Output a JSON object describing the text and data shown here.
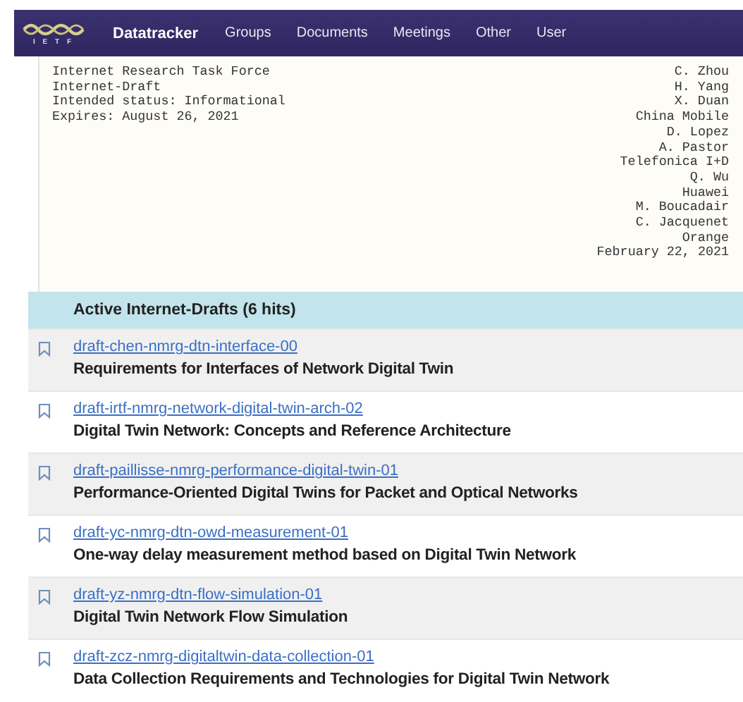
{
  "navbar": {
    "logo_text": "I E T F",
    "brand": "Datatracker",
    "items": [
      "Groups",
      "Documents",
      "Meetings",
      "Other",
      "User"
    ]
  },
  "document": {
    "header_left": [
      "Internet Research Task Force",
      "Internet-Draft",
      "Intended status: Informational",
      "Expires: August 26, 2021"
    ],
    "header_right": [
      "C. Zhou",
      "H. Yang",
      "X. Duan",
      "China Mobile",
      "D. Lopez",
      "A. Pastor",
      "Telefonica I+D",
      "Q. Wu",
      "Huawei",
      "M. Boucadair",
      "C. Jacquenet",
      "Orange",
      "February 22, 2021"
    ]
  },
  "results": {
    "heading": "Active Internet-Drafts (6 hits)",
    "drafts": [
      {
        "name": "draft-chen-nmrg-dtn-interface-00",
        "title": "Requirements for Interfaces of Network Digital Twin"
      },
      {
        "name": "draft-irtf-nmrg-network-digital-twin-arch-02",
        "title": "Digital Twin Network: Concepts and Reference Architecture"
      },
      {
        "name": "draft-paillisse-nmrg-performance-digital-twin-01",
        "title": "Performance-Oriented Digital Twins for Packet and Optical Networks"
      },
      {
        "name": "draft-yc-nmrg-dtn-owd-measurement-01",
        "title": "One-way delay measurement method based on Digital Twin Network"
      },
      {
        "name": "draft-yz-nmrg-dtn-flow-simulation-01",
        "title": "Digital Twin Network Flow Simulation"
      },
      {
        "name": "draft-zcz-nmrg-digitaltwin-data-collection-01",
        "title": "Data Collection Requirements and Technologies for Digital Twin Network"
      }
    ]
  }
}
